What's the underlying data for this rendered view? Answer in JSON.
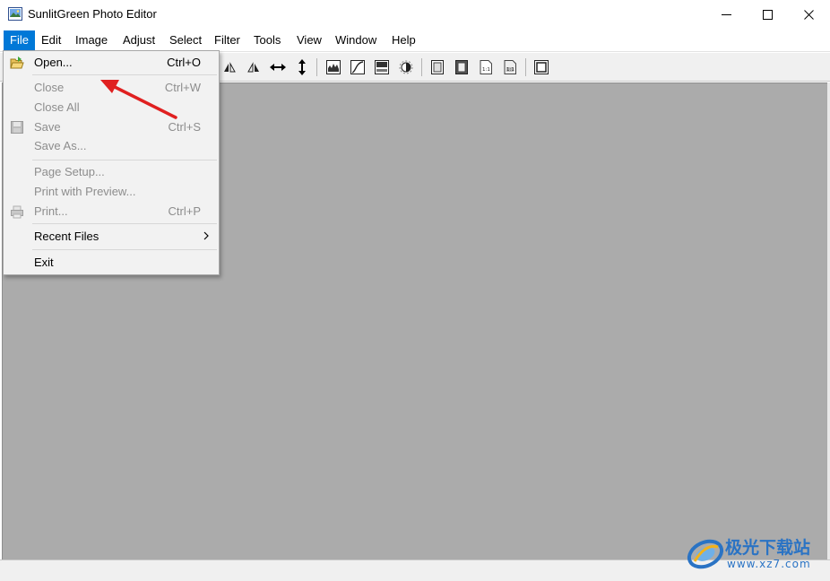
{
  "window": {
    "title": "SunlitGreen Photo Editor",
    "icons": {
      "app": "app-image-icon",
      "minimize": "minimize-icon",
      "maximize": "maximize-icon",
      "close": "close-icon"
    }
  },
  "menubar": {
    "items": [
      {
        "label": "File",
        "active": true
      },
      {
        "label": "Edit"
      },
      {
        "label": "Image"
      },
      {
        "label": "Adjust"
      },
      {
        "label": "Select"
      },
      {
        "label": "Filter"
      },
      {
        "label": "Tools"
      },
      {
        "label": "View"
      },
      {
        "label": "Window"
      },
      {
        "label": "Help"
      }
    ]
  },
  "toolbar": {
    "buttons": [
      "flip-vertical-icon",
      "flip-horizontal-icon",
      "stretch-horizontal-icon",
      "stretch-vertical-icon",
      "histogram-icon",
      "curves-icon",
      "levels-icon",
      "brightness-icon",
      "frame-icon",
      "frame-shadow-icon",
      "actual-size-icon",
      "fit-size-icon",
      "fullscreen-icon"
    ]
  },
  "file_menu": {
    "items": [
      {
        "label": "Open...",
        "shortcut": "Ctrl+O",
        "enabled": true,
        "icon": "open-folder-icon"
      },
      {
        "label": "Close",
        "shortcut": "Ctrl+W",
        "enabled": false
      },
      {
        "label": "Close All",
        "shortcut": "",
        "enabled": false
      },
      {
        "label": "Save",
        "shortcut": "Ctrl+S",
        "enabled": false,
        "icon": "save-disk-icon"
      },
      {
        "label": "Save As...",
        "shortcut": "",
        "enabled": false
      },
      {
        "label": "Page Setup...",
        "shortcut": "",
        "enabled": false
      },
      {
        "label": "Print with Preview...",
        "shortcut": "",
        "enabled": false
      },
      {
        "label": "Print...",
        "shortcut": "Ctrl+P",
        "enabled": false,
        "icon": "printer-icon"
      },
      {
        "label": "Recent Files",
        "shortcut": "",
        "enabled": true,
        "submenu": true
      },
      {
        "label": "Exit",
        "shortcut": "",
        "enabled": true
      }
    ]
  },
  "annotation": {
    "color": "#e02020"
  },
  "watermark": {
    "line1": "极光下载站",
    "line2": "www.xz7.com",
    "color": "#2a73c4"
  },
  "colors": {
    "accent": "#0078d7",
    "workspace": "#ababab",
    "menu_bg": "#f2f2f2",
    "disabled_text": "#8d8d8d"
  }
}
